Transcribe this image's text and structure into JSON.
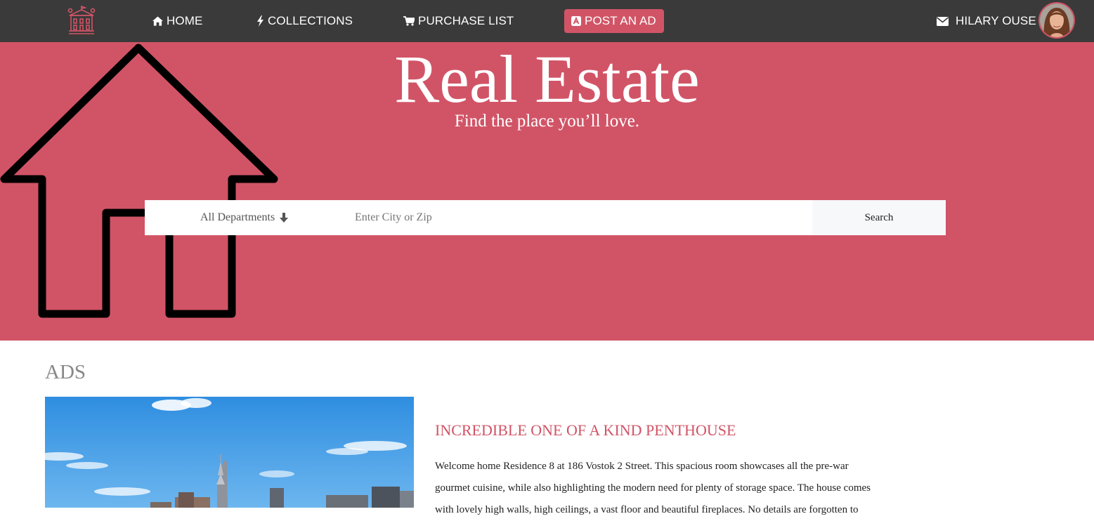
{
  "nav": {
    "logo_icon": "mansion-logo-icon",
    "home": "HOME",
    "collections": "COLLECTIONS",
    "purchase_list": "PURCHASE LIST",
    "post_ad": "POST AN AD",
    "user_name": "HILARY OUSE"
  },
  "hero": {
    "title": "Real Estate",
    "subtitle": "Find the place you’ll love."
  },
  "search": {
    "department": "All Departments",
    "placeholder": "Enter City or Zip",
    "value": "",
    "button": "Search"
  },
  "ads": {
    "heading": "ADS",
    "items": [
      {
        "title": "INCREDIBLE ONE OF A KIND PENTHOUSE",
        "description": "Welcome home Residence 8 at 186 Vostok 2 Street. This spacious room showcases all the pre-war gourmet cuisine, while also highlighting the modern need for plenty of storage space. The house comes with lovely high walls, high ceilings, a vast floor and beautiful fireplaces. No details are forgotten to"
      }
    ]
  },
  "colors": {
    "navbar": "#3a3a3a",
    "accent": "#d15466",
    "heading_gray": "#888888"
  }
}
